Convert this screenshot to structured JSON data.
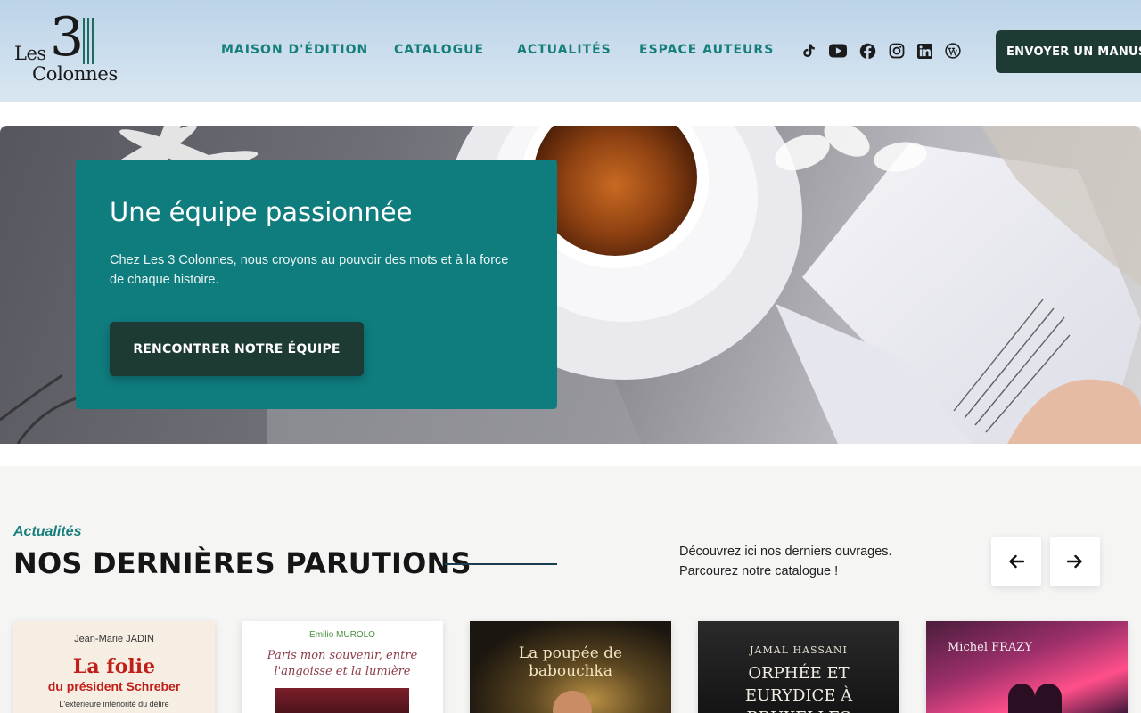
{
  "logo": {
    "les": "Les",
    "number": "3",
    "colonnes": "Colonnes"
  },
  "nav": {
    "items": [
      {
        "label": "MAISON D'ÉDITION"
      },
      {
        "label": "CATALOGUE"
      },
      {
        "label": "ACTUALITÉS"
      },
      {
        "label": "ESPACE AUTEURS"
      }
    ]
  },
  "social": [
    "tiktok-icon",
    "youtube-icon",
    "facebook-icon",
    "instagram-icon",
    "linkedin-icon",
    "wordpress-icon"
  ],
  "header_cta": {
    "label": "ENVOYER UN MANUSCRIT"
  },
  "hero": {
    "title": "Une équipe passionnée",
    "text": "Chez Les 3 Colonnes, nous croyons au pouvoir des mots et à la force de chaque histoire.",
    "button": "RENCONTRER NOTRE ÉQUIPE"
  },
  "parutions": {
    "kicker": "Actualités",
    "title": "NOS DERNIÈRES PARUTIONS",
    "desc_line1": "Découvrez ici nos derniers ouvrages.",
    "desc_line2": "Parcourez notre catalogue !",
    "prev": "arrow-left-icon",
    "next": "arrow-right-icon"
  },
  "books": [
    {
      "author": "Jean-Marie JADIN",
      "title": "La folie",
      "subtitle": "du président Schreber",
      "tagline": "L'extérieure intériorité du délire"
    },
    {
      "author": "Emilio MUROLO",
      "title": "Paris mon souvenir, entre l'angoisse et la lumière"
    },
    {
      "title": "La poupée de babouchka"
    },
    {
      "author": "JAMAL HASSANI",
      "title": "ORPHÉE ET EURYDICE À BRUXELLES"
    },
    {
      "author": "Michel FRAZY"
    }
  ],
  "colors": {
    "teal": "#0f7c7e",
    "nav_teal": "#177f7b",
    "dark_green": "#1d3b34"
  }
}
